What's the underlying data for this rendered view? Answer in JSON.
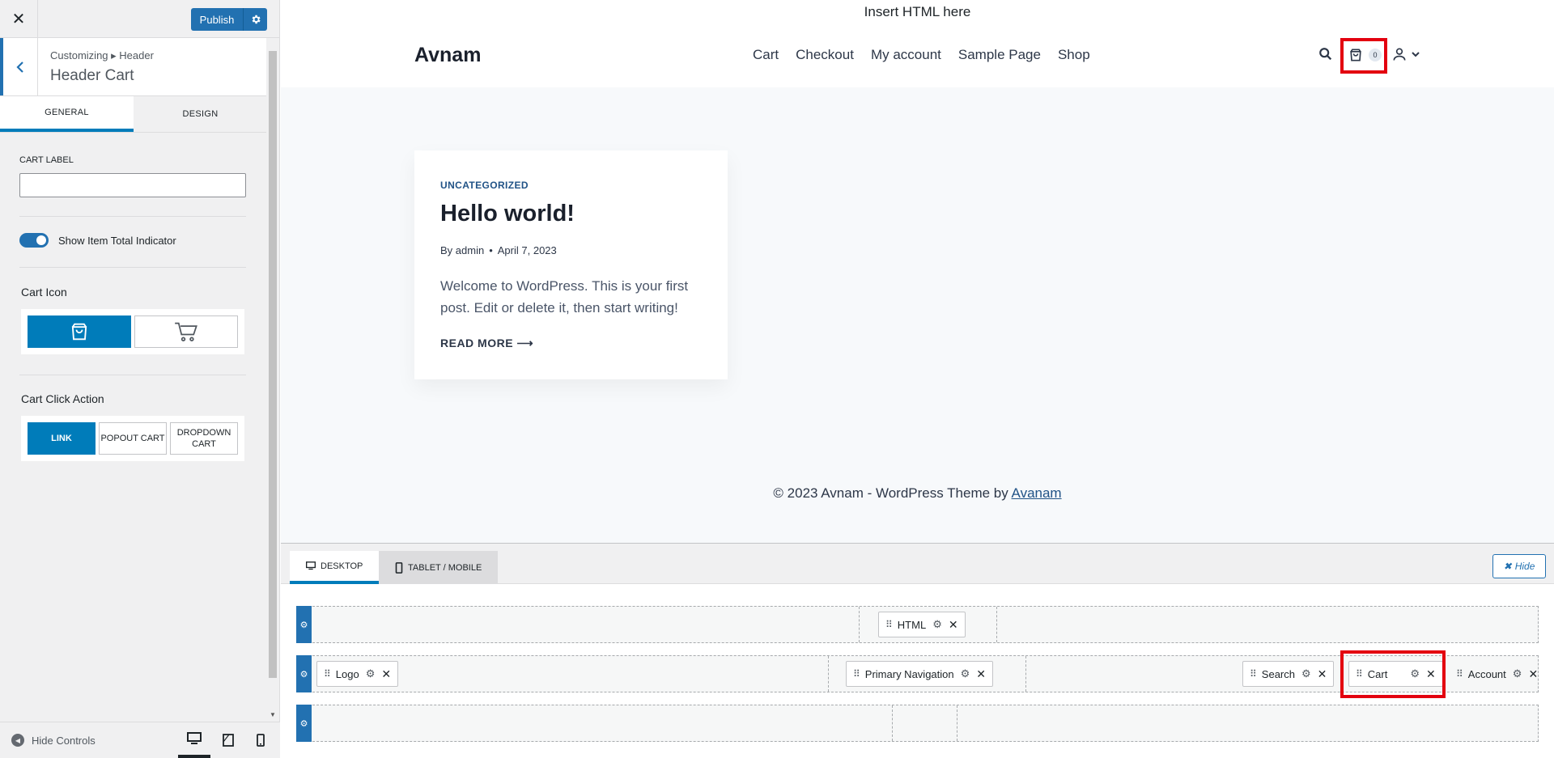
{
  "sidebar": {
    "publish_label": "Publish",
    "breadcrumb": "Customizing ▸ Header",
    "section_title": "Header Cart",
    "tabs": [
      {
        "label": "GENERAL",
        "active": true
      },
      {
        "label": "DESIGN",
        "active": false
      }
    ],
    "cart_label": {
      "label": "CART LABEL",
      "value": ""
    },
    "toggle": {
      "label": "Show Item Total Indicator",
      "on": true
    },
    "cart_icon": {
      "title": "Cart Icon",
      "options": [
        "shopping-bag-icon",
        "shopping-cart-icon"
      ],
      "selected": 0
    },
    "click_action": {
      "title": "Cart Click Action",
      "options": [
        "LINK",
        "POPOUT CART",
        "DROPDOWN CART"
      ],
      "selected": 0
    },
    "footer": {
      "hide_controls": "Hide Controls",
      "devices": [
        "desktop",
        "tablet",
        "mobile"
      ],
      "active_device": "desktop"
    }
  },
  "preview": {
    "top_html": "Insert HTML here",
    "logo": "Avnam",
    "nav": [
      "Cart",
      "Checkout",
      "My account",
      "Sample Page",
      "Shop"
    ],
    "cart_count": "0",
    "post": {
      "category": "UNCATEGORIZED",
      "title": "Hello world!",
      "author": "By admin",
      "date": "April 7, 2023",
      "excerpt": "Welcome to WordPress. This is your first post. Edit or delete it, then start writing!",
      "read_more": "READ MORE"
    },
    "footer_text": "© 2023 Avnam - WordPress Theme by ",
    "footer_link": "Avanam"
  },
  "builder": {
    "tabs": [
      {
        "label": "DESKTOP",
        "active": true
      },
      {
        "label": "TABLET / MOBILE",
        "active": false
      }
    ],
    "hide_label": "Hide",
    "rows": [
      {
        "items": [
          "HTML"
        ]
      },
      {
        "items": [
          "Logo",
          "Primary Navigation",
          "Search",
          "Cart",
          "Account"
        ]
      },
      {
        "items": []
      }
    ]
  },
  "colors": {
    "accent": "#2271b1",
    "highlight": "#e3000f",
    "button_selected": "#007cba"
  }
}
